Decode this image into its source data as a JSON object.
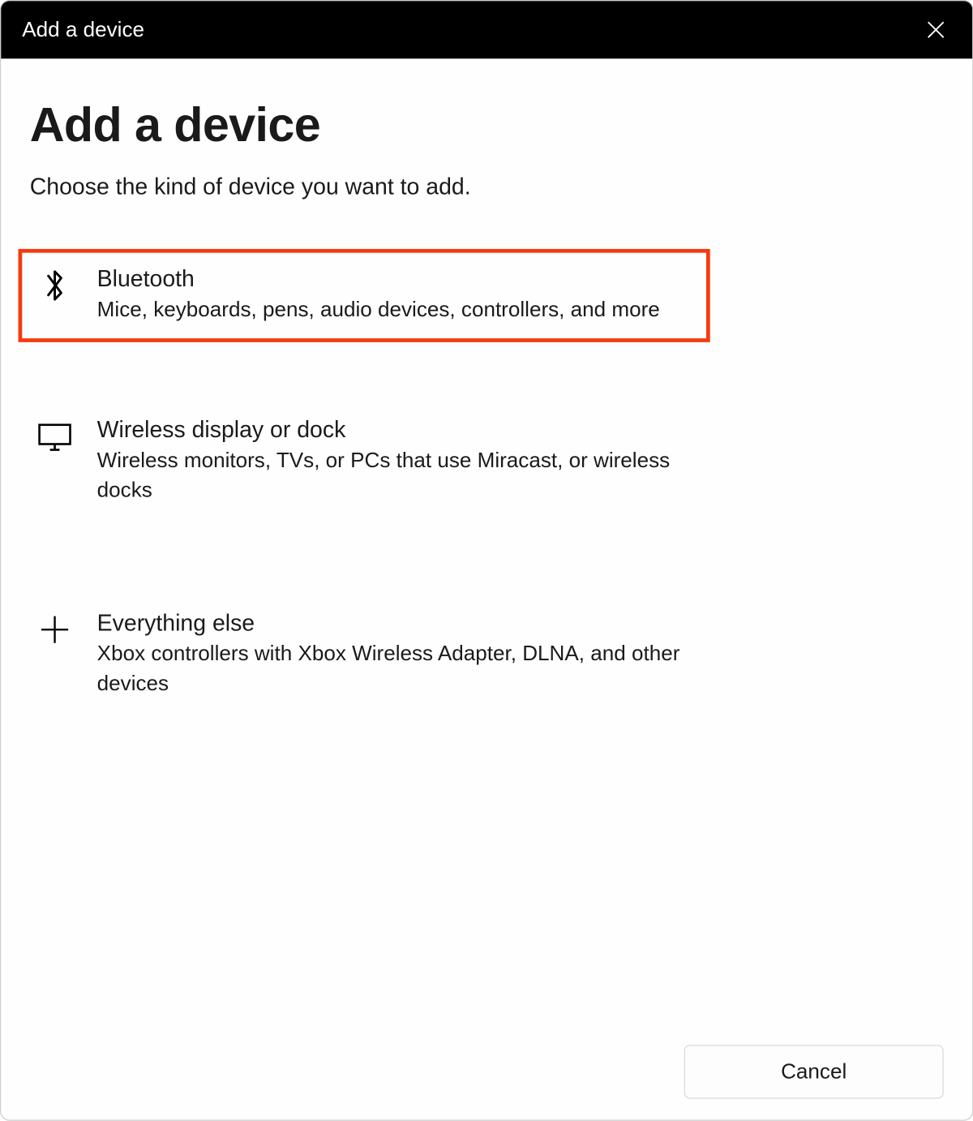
{
  "titlebar": {
    "title": "Add a device"
  },
  "main": {
    "heading": "Add a device",
    "subheading": "Choose the kind of device you want to add."
  },
  "options": [
    {
      "title": "Bluetooth",
      "description": "Mice, keyboards, pens, audio devices, controllers, and more",
      "highlighted": true
    },
    {
      "title": "Wireless display or dock",
      "description": "Wireless monitors, TVs, or PCs that use Miracast, or wireless docks",
      "highlighted": false
    },
    {
      "title": "Everything else",
      "description": "Xbox controllers with Xbox Wireless Adapter, DLNA, and other devices",
      "highlighted": false
    }
  ],
  "footer": {
    "cancel_label": "Cancel"
  }
}
